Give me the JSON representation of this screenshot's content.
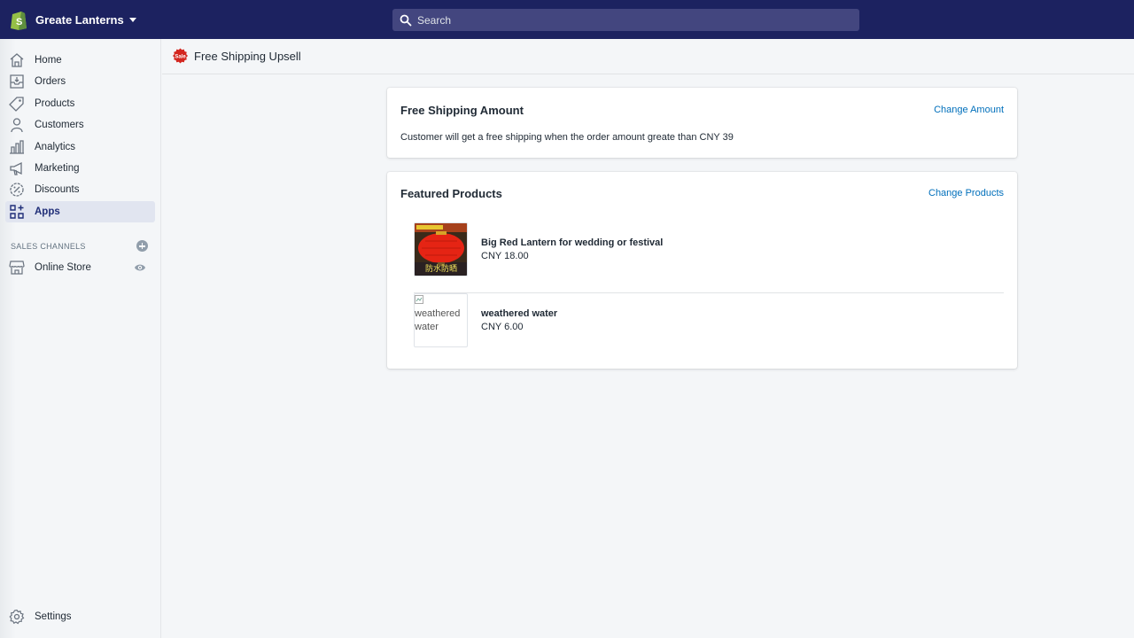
{
  "topbar": {
    "store_name": "Greate Lanterns",
    "search_placeholder": "Search"
  },
  "sidebar": {
    "items": [
      {
        "label": "Home",
        "icon": "home-icon"
      },
      {
        "label": "Orders",
        "icon": "orders-icon"
      },
      {
        "label": "Products",
        "icon": "tag-icon"
      },
      {
        "label": "Customers",
        "icon": "person-icon"
      },
      {
        "label": "Analytics",
        "icon": "bar-chart-icon"
      },
      {
        "label": "Marketing",
        "icon": "megaphone-icon"
      },
      {
        "label": "Discounts",
        "icon": "discount-icon"
      },
      {
        "label": "Apps",
        "icon": "apps-icon",
        "active": true
      }
    ],
    "sales_channels_heading": "SALES CHANNELS",
    "online_store_label": "Online Store",
    "settings_label": "Settings"
  },
  "page": {
    "title": "Free Shipping Upsell",
    "badge_text": "Sale"
  },
  "shipping_card": {
    "title": "Free Shipping Amount",
    "action": "Change Amount",
    "description": "Customer will get a free shipping when the order amount greate than CNY 39"
  },
  "products_card": {
    "title": "Featured Products",
    "action": "Change Products",
    "products": [
      {
        "name": "Big Red Lantern for wedding or festival",
        "price": "CNY 18.00",
        "image_caption": "防水防晒"
      },
      {
        "name": "weathered water",
        "price": "CNY 6.00",
        "image_alt": "weathered water"
      }
    ]
  },
  "colors": {
    "topbar": "#1c2260",
    "accent_link": "#006fbb",
    "active_nav": "#202e78"
  }
}
